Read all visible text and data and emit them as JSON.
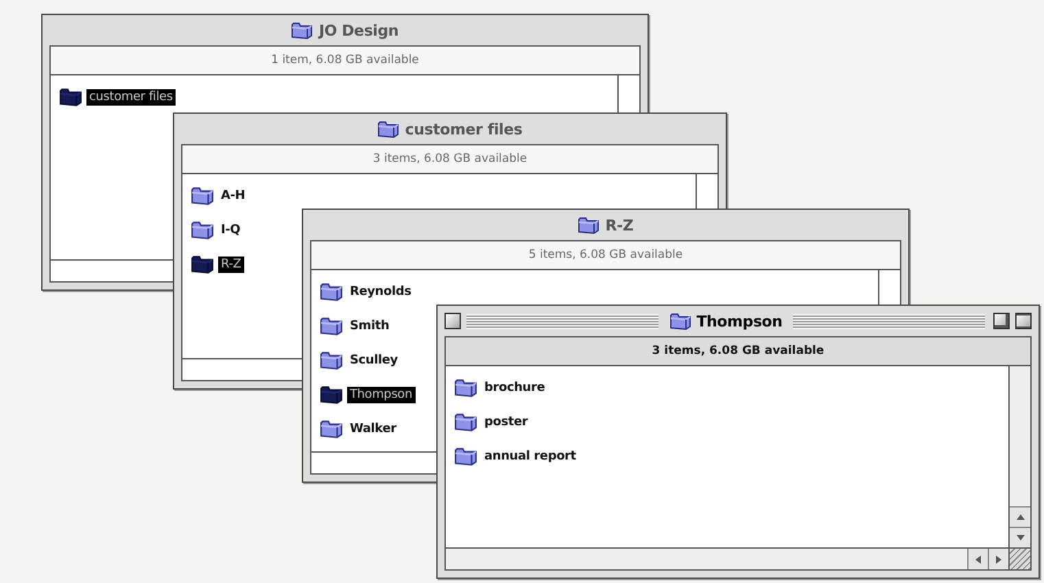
{
  "windows": [
    {
      "title": "JO Design",
      "status": "1 item, 6.08 GB available",
      "active": false,
      "items": [
        {
          "label": "customer files",
          "selected": true
        }
      ]
    },
    {
      "title": "customer files",
      "status": "3 items, 6.08 GB available",
      "active": false,
      "items": [
        {
          "label": "A-H",
          "selected": false
        },
        {
          "label": "I-Q",
          "selected": false
        },
        {
          "label": "R-Z",
          "selected": true
        }
      ]
    },
    {
      "title": "R-Z",
      "status": "5 items, 6.08 GB available",
      "active": false,
      "items": [
        {
          "label": "Reynolds",
          "selected": false
        },
        {
          "label": "Smith",
          "selected": false
        },
        {
          "label": "Sculley",
          "selected": false
        },
        {
          "label": "Thompson",
          "selected": true
        },
        {
          "label": "Walker",
          "selected": false
        }
      ]
    },
    {
      "title": "Thompson",
      "status": "3 items, 6.08 GB available",
      "active": true,
      "items": [
        {
          "label": "brochure",
          "selected": false
        },
        {
          "label": "poster",
          "selected": false
        },
        {
          "label": "annual report",
          "selected": false
        }
      ]
    }
  ]
}
